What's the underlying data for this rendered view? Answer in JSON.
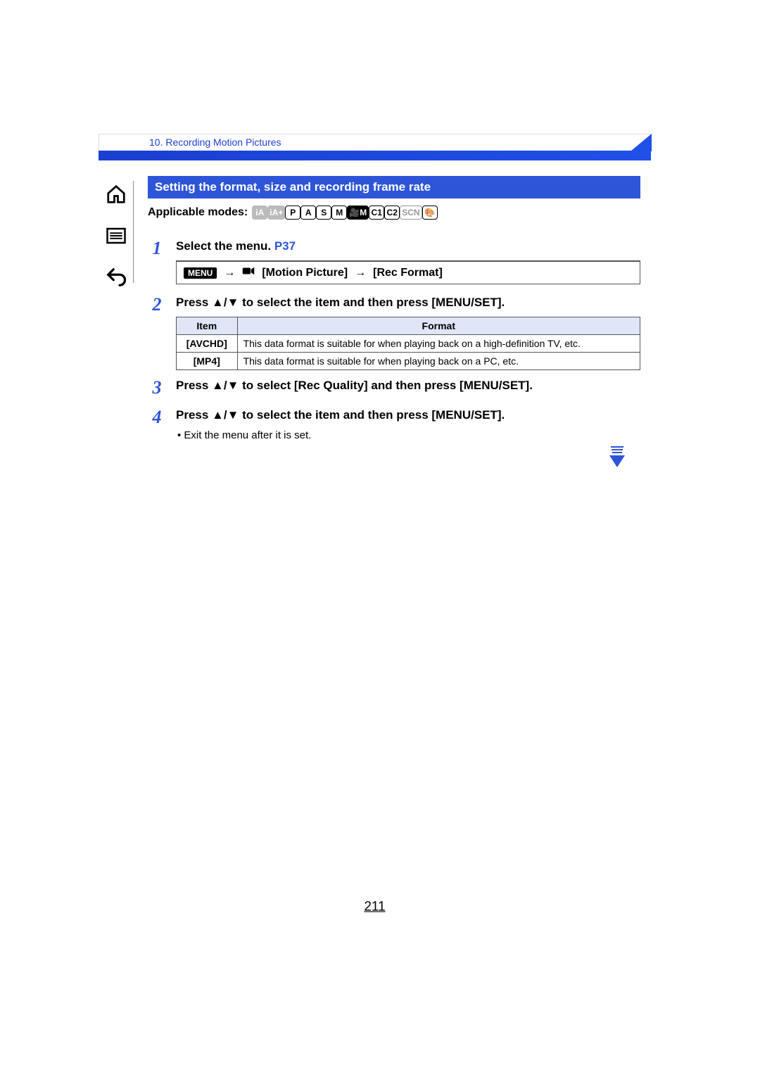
{
  "breadcrumb": "10. Recording Motion Pictures",
  "section_title": "Setting the format, size and recording frame rate",
  "modes_label": "Applicable modes:",
  "modes": [
    {
      "label": "iA",
      "dim": true,
      "filled": true
    },
    {
      "label": "iA+",
      "dim": true,
      "filled": true
    },
    {
      "label": "P",
      "dim": false
    },
    {
      "label": "A",
      "dim": false
    },
    {
      "label": "S",
      "dim": false
    },
    {
      "label": "M",
      "dim": false
    },
    {
      "label": "🎥M",
      "dim": false,
      "filled": true
    },
    {
      "label": "C1",
      "dim": false
    },
    {
      "label": "C2",
      "dim": false
    },
    {
      "label": "SCN",
      "dim": true
    },
    {
      "label": "🎨",
      "dim": false
    }
  ],
  "steps": {
    "1": {
      "title_pre": "Select the menu. ",
      "title_link": "P37",
      "menu_label": "MENU",
      "arrow": "→",
      "path1": "[Motion Picture]",
      "path2": "[Rec Format]"
    },
    "2": {
      "title": "Press ▲/▼ to select the item and then press [MENU/SET].",
      "table_header_item": "Item",
      "table_header_format": "Format",
      "rows": [
        {
          "item": "[AVCHD]",
          "desc": "This data format is suitable for when playing back on a high-definition TV, etc."
        },
        {
          "item": "[MP4]",
          "desc": "This data format is suitable for when playing back on a PC, etc."
        }
      ]
    },
    "3": {
      "title": "Press ▲/▼ to select [Rec Quality] and then press [MENU/SET]."
    },
    "4": {
      "title": "Press ▲/▼ to select the item and then press [MENU/SET].",
      "note": "• Exit the menu after it is set."
    }
  },
  "page_number": "211"
}
